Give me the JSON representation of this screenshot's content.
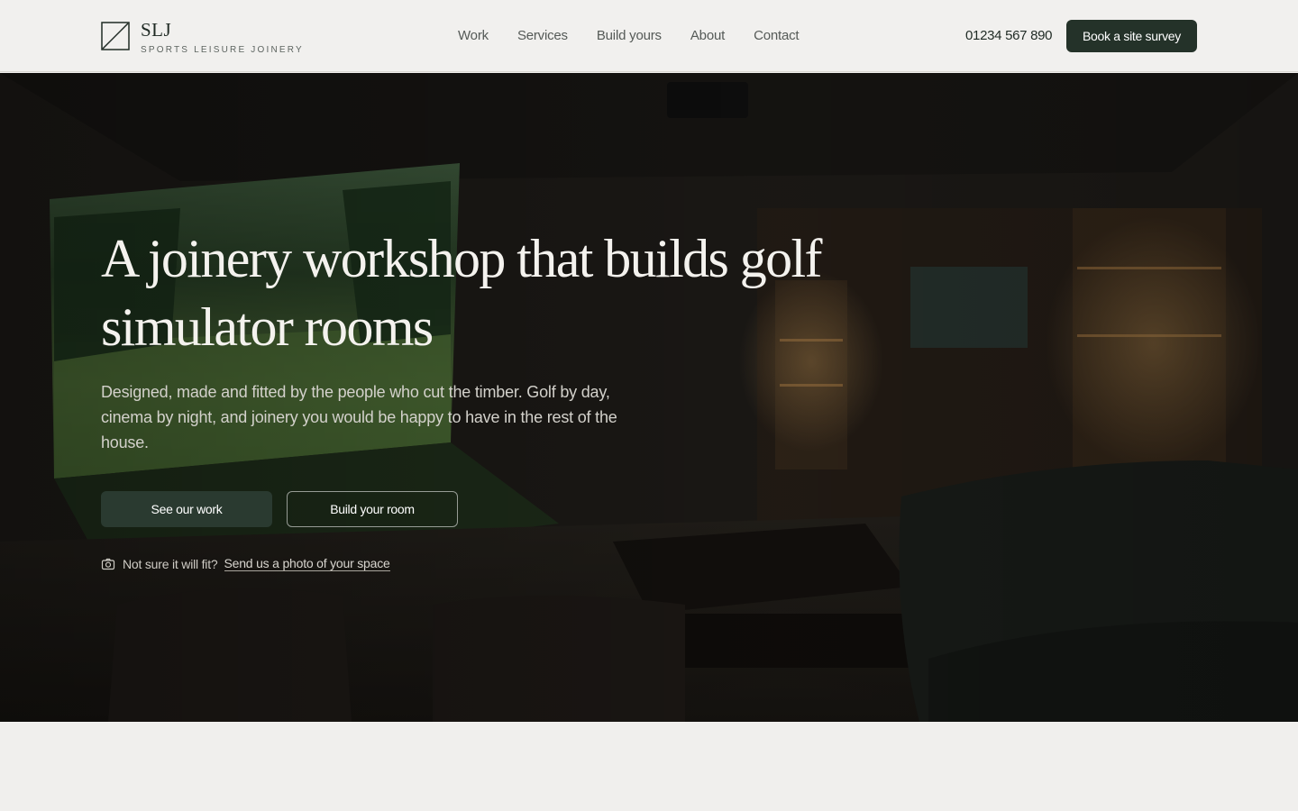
{
  "brand": {
    "name": "SLJ",
    "tagline": "SPORTS LEISURE JOINERY",
    "logo_icon": "diagonal-square-icon"
  },
  "nav": {
    "items": [
      {
        "label": "Work"
      },
      {
        "label": "Services"
      },
      {
        "label": "Build yours"
      },
      {
        "label": "About"
      },
      {
        "label": "Contact"
      }
    ]
  },
  "header": {
    "phone": "01234 567 890",
    "cta_label": "Book a site survey"
  },
  "hero": {
    "title": "A joinery workshop that builds golf simulator rooms",
    "subtitle": "Designed, made and fitted by the people who cut the timber. Golf by day, cinema by night, and joinery you would be happy to have in the rest of the house.",
    "primary_button": "See our work",
    "secondary_button": "Build your room",
    "note_text": "Not sure it will fit?",
    "note_link": "Send us a photo of your space",
    "note_icon": "camera-icon"
  },
  "colors": {
    "brand_dark": "#243229",
    "background": "#f0efed"
  }
}
